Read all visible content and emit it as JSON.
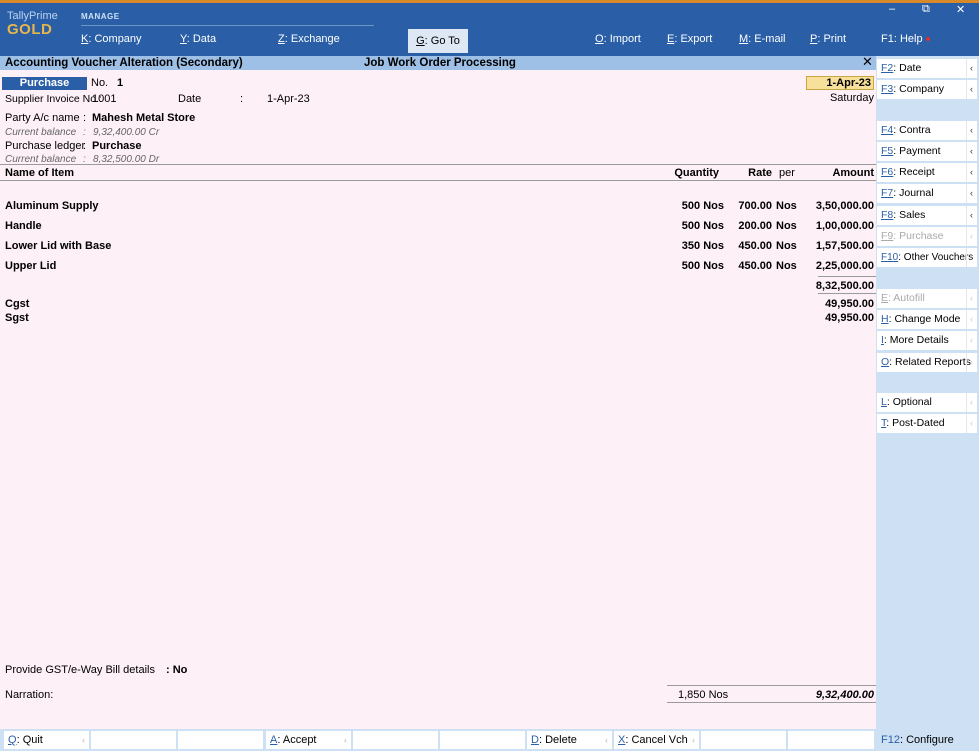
{
  "app": {
    "name": "TallyPrime",
    "edition": "GOLD",
    "section": "MANAGE"
  },
  "top_menu": [
    {
      "key": "K",
      "label": "Company"
    },
    {
      "key": "Y",
      "label": "Data"
    },
    {
      "key": "Z",
      "label": "Exchange"
    },
    {
      "key": "G",
      "label": "Go To"
    },
    {
      "key": "O",
      "label": "Import"
    },
    {
      "key": "E",
      "label": "Export"
    },
    {
      "key": "M",
      "label": "E-mail"
    },
    {
      "key": "P",
      "label": "Print"
    },
    {
      "key": "F1",
      "label": "Help"
    }
  ],
  "window_controls": {
    "minimize": "–",
    "restore": "⧉",
    "close": "✕"
  },
  "title": {
    "left": "Accounting Voucher Alteration (Secondary)",
    "center": "Job Work Order Processing",
    "close": "✕"
  },
  "voucher": {
    "type": "Purchase",
    "no_label": "No.",
    "no": "1",
    "date": "1-Apr-23",
    "day": "Saturday",
    "supplier_invoice_label": "Supplier Invoice No.:",
    "supplier_invoice_no": "1001",
    "date_label": "Date",
    "date_sep": ":",
    "invoice_date": "1-Apr-23",
    "party_label": "Party A/c name",
    "party_sep": ":",
    "party_name": "Mahesh Metal Store",
    "party_balance_label": "Current balance",
    "party_balance_sep": ":",
    "party_balance": "9,32,400.00 Cr",
    "purchase_ledger_label": "Purchase ledger",
    "purchase_ledger_sep": ":",
    "purchase_ledger": "Purchase",
    "purchase_balance_label": "Current balance",
    "purchase_balance_sep": ":",
    "purchase_balance": "8,32,500.00 Dr"
  },
  "columns": {
    "item": "Name of Item",
    "quantity": "Quantity",
    "rate": "Rate",
    "per": "per",
    "amount": "Amount"
  },
  "items": [
    {
      "name": "Aluminum Supply",
      "quantity": "500 Nos",
      "rate": "700.00",
      "per": "Nos",
      "amount": "3,50,000.00"
    },
    {
      "name": "Handle",
      "quantity": "500 Nos",
      "rate": "200.00",
      "per": "Nos",
      "amount": "1,00,000.00"
    },
    {
      "name": "Lower Lid with Base",
      "quantity": "350 Nos",
      "rate": "450.00",
      "per": "Nos",
      "amount": "1,57,500.00"
    },
    {
      "name": "Upper Lid",
      "quantity": "500 Nos",
      "rate": "450.00",
      "per": "Nos",
      "amount": "2,25,000.00"
    }
  ],
  "subtotal": "8,32,500.00",
  "taxes": [
    {
      "name": "Cgst",
      "amount": "49,950.00"
    },
    {
      "name": "Sgst",
      "amount": "49,950.00"
    }
  ],
  "gst_label": "Provide GST/e-Way Bill details",
  "gst_value": ": No",
  "narration_label": "Narration:",
  "total_quantity": "1,850 Nos",
  "grand_total": "9,32,400.00",
  "right_panel": [
    {
      "key": "F2",
      "label": "Date",
      "enabled": true
    },
    {
      "key": "F3",
      "label": "Company",
      "enabled": true
    },
    {
      "key": "F4",
      "label": "Contra",
      "enabled": true
    },
    {
      "key": "F5",
      "label": "Payment",
      "enabled": true
    },
    {
      "key": "F6",
      "label": "Receipt",
      "enabled": true
    },
    {
      "key": "F7",
      "label": "Journal",
      "enabled": true
    },
    {
      "key": "F8",
      "label": "Sales",
      "enabled": true
    },
    {
      "key": "F9",
      "label": "Purchase",
      "enabled": false
    },
    {
      "key": "F10",
      "label": "Other Vouchers",
      "enabled": true
    },
    {
      "key": "E",
      "label": "Autofill",
      "enabled": false
    },
    {
      "key": "H",
      "label": "Change Mode",
      "enabled": true
    },
    {
      "key": "I",
      "label": "More Details",
      "enabled": true
    },
    {
      "key": "O",
      "label": "Related Reports",
      "enabled": true
    },
    {
      "key": "L",
      "label": "Optional",
      "enabled": true
    },
    {
      "key": "T",
      "label": "Post-Dated",
      "enabled": true
    }
  ],
  "bottom_bar": [
    {
      "key": "Q",
      "label": "Quit"
    },
    {
      "key": "A",
      "label": "Accept"
    },
    {
      "key": "D",
      "label": "Delete"
    },
    {
      "key": "X",
      "label": "Cancel Vch"
    }
  ],
  "configure": {
    "key": "F12",
    "label": "Configure"
  },
  "colors": {
    "brand_blue": "#2a5fa8",
    "title_bar": "#9ec0e6",
    "voucher_bg": "#fdf0f6",
    "panel_bg": "#cde0f4",
    "date_highlight": "#f7e19a",
    "gold": "#e8b64a"
  }
}
